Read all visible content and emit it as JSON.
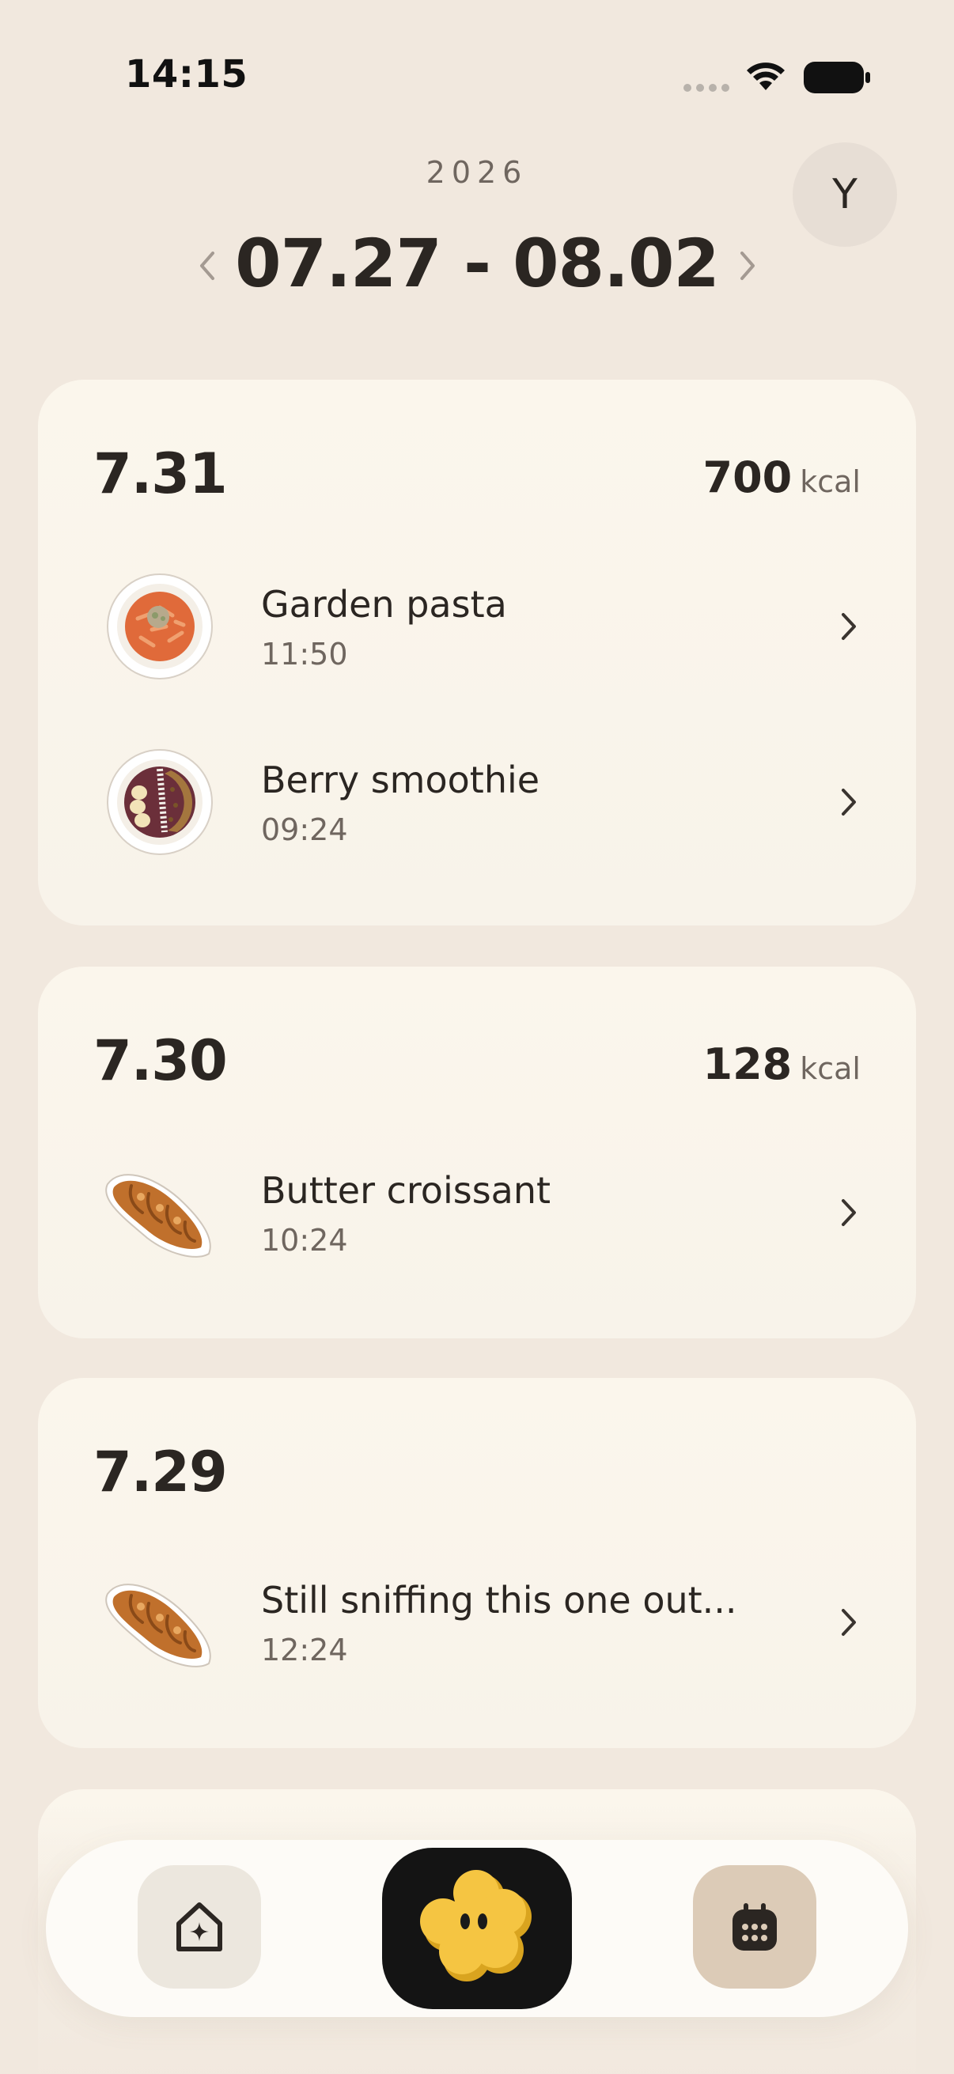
{
  "status_bar": {
    "time": "14:15"
  },
  "header": {
    "year": "2026",
    "range": "07.27 - 08.02",
    "avatar_initial": "Y"
  },
  "days": [
    {
      "date": "7.31",
      "kcal_value": "700",
      "kcal_unit": "kcal",
      "meals": [
        {
          "name": "Garden pasta",
          "time": "11:50",
          "icon": "pasta-plate-icon"
        },
        {
          "name": "Berry smoothie",
          "time": "09:24",
          "icon": "smoothie-bowl-icon"
        }
      ]
    },
    {
      "date": "7.30",
      "kcal_value": "128",
      "kcal_unit": "kcal",
      "meals": [
        {
          "name": "Butter croissant",
          "time": "10:24",
          "icon": "croissant-icon"
        }
      ]
    },
    {
      "date": "7.29",
      "meals": [
        {
          "name": "Still sniffing this one out...",
          "time": "12:24",
          "icon": "croissant-icon"
        }
      ]
    }
  ],
  "bottom_nav": {
    "home_icon": "home-sparkle-icon",
    "center_icon": "flower-mascot-icon",
    "calendar_icon": "calendar-icon"
  },
  "colors": {
    "background": "#f1e8de",
    "card": "#fbf6ec",
    "text_primary": "#2b2622",
    "text_secondary": "#6f665f",
    "accent_yellow": "#f5c542",
    "nav_center": "#141414",
    "nav_calendar": "#dccbb7"
  }
}
